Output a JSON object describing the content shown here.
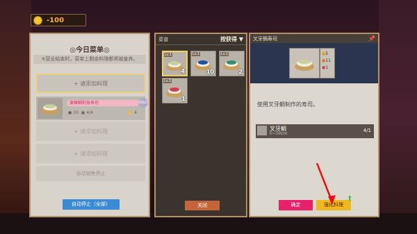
{
  "coins": {
    "value": "-100",
    "color": "#f4c430"
  },
  "menu_panel": {
    "title": "◎今日菜单◎",
    "note": "※营业结束时，菜单上剩余料理都将被废弃。",
    "add_label": "+ 请添加料理",
    "dish": {
      "name": "黄鳍鲷刺身寿司",
      "badge": "SOLD",
      "stock": "4/4",
      "price": "10",
      "qty": "4"
    },
    "empty_slots": [
      "+ 请添加料理",
      "+ 请添加料理"
    ],
    "auto_slot_label": "自动销售停止",
    "auto_stop_button": "自动停止（全部）"
  },
  "dish_list": {
    "header": "菜谱",
    "sort_label": "按获得",
    "sort_icon": "triangle-down-icon",
    "items": [
      {
        "level": "Lv.1",
        "count": "4",
        "selected": true
      },
      {
        "level": "Lv.1",
        "count": "10",
        "selected": false
      },
      {
        "level": "Lv.1",
        "count": "2",
        "selected": false
      },
      {
        "level": "Lv.1",
        "count": "1",
        "selected": false
      }
    ],
    "close_button": "关闭"
  },
  "detail": {
    "title": "叉牙鲷寿司",
    "stats": [
      "5",
      "11",
      "1"
    ],
    "description": "使用叉牙鲷制作的寿司。",
    "ingredient": {
      "name": "叉牙鲷",
      "sub": "0~50cm",
      "count": "4/1"
    },
    "confirm_button": "确定",
    "upgrade_button": "强化料理",
    "colors": {
      "confirm": "#e8206a",
      "upgrade": "#f0b820",
      "band": "#2c3550"
    }
  }
}
